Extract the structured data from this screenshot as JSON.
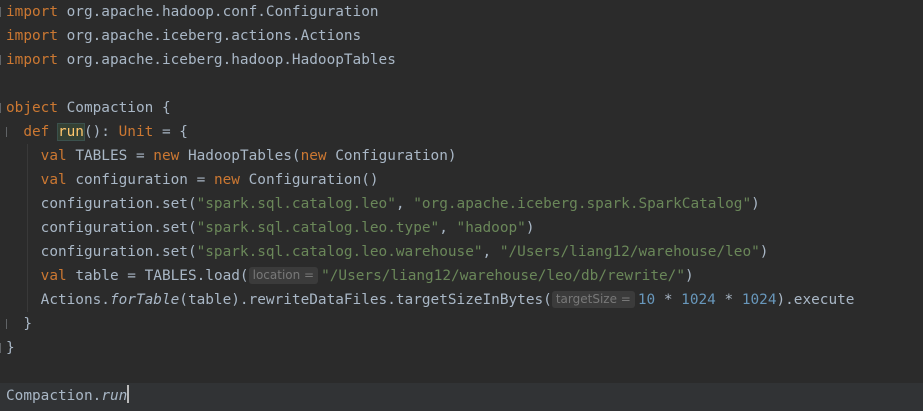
{
  "editor": {
    "lines": [
      {
        "import_kw": "import",
        "path": " org.apache.hadoop.conf.Configuration"
      },
      {
        "import_kw": "import",
        "path": " org.apache.iceberg.actions.Actions"
      },
      {
        "import_kw": "import",
        "path": " org.apache.iceberg.hadoop.HadoopTables"
      }
    ],
    "object_kw": "object",
    "object_name": " Compaction {",
    "def_kw": "def ",
    "def_name": "run",
    "def_sig_a": "(): ",
    "def_type": "Unit",
    "def_sig_b": " = {",
    "val_kw": "val",
    "new_kw": "new",
    "tables_decl": " TABLES = ",
    "tables_ctor_a": " HadoopTables(",
    "tables_ctor_b": " Configuration)",
    "config_decl": " configuration = ",
    "config_ctor": " Configuration()",
    "set_call": "configuration.set(",
    "set1_key": "\"spark.sql.catalog.leo\"",
    "set1_val": "\"org.apache.iceberg.spark.SparkCatalog\"",
    "set2_key": "\"spark.sql.catalog.leo.type\"",
    "set2_val": "\"hadoop\"",
    "set3_key": "\"spark.sql.catalog.leo.warehouse\"",
    "set3_val": "\"/Users/liang12/warehouse/leo\"",
    "sep": ", ",
    "close_paren": ")",
    "table_decl": " table = TABLES.load(",
    "hint_location": "location =",
    "table_path": "\"/Users/liang12/warehouse/leo/db/rewrite/\"",
    "actions_a": "Actions.",
    "actions_fn": "forTable",
    "actions_b": "(table).rewriteDataFiles.targetSizeInBytes(",
    "hint_target": "targetSize =",
    "num_10": "10",
    "mul": " * ",
    "num_1024": "1024",
    "actions_end": ").execute",
    "close_inner": "}",
    "close_outer": "}"
  },
  "bottom": {
    "prefix": "Compaction.",
    "method": "run"
  },
  "colors": {
    "background": "#2b2b2b",
    "keyword": "#cc7832",
    "string": "#6a8759",
    "number": "#6897bb",
    "default_text": "#a9b7c6",
    "function_decl": "#ffc66d"
  }
}
